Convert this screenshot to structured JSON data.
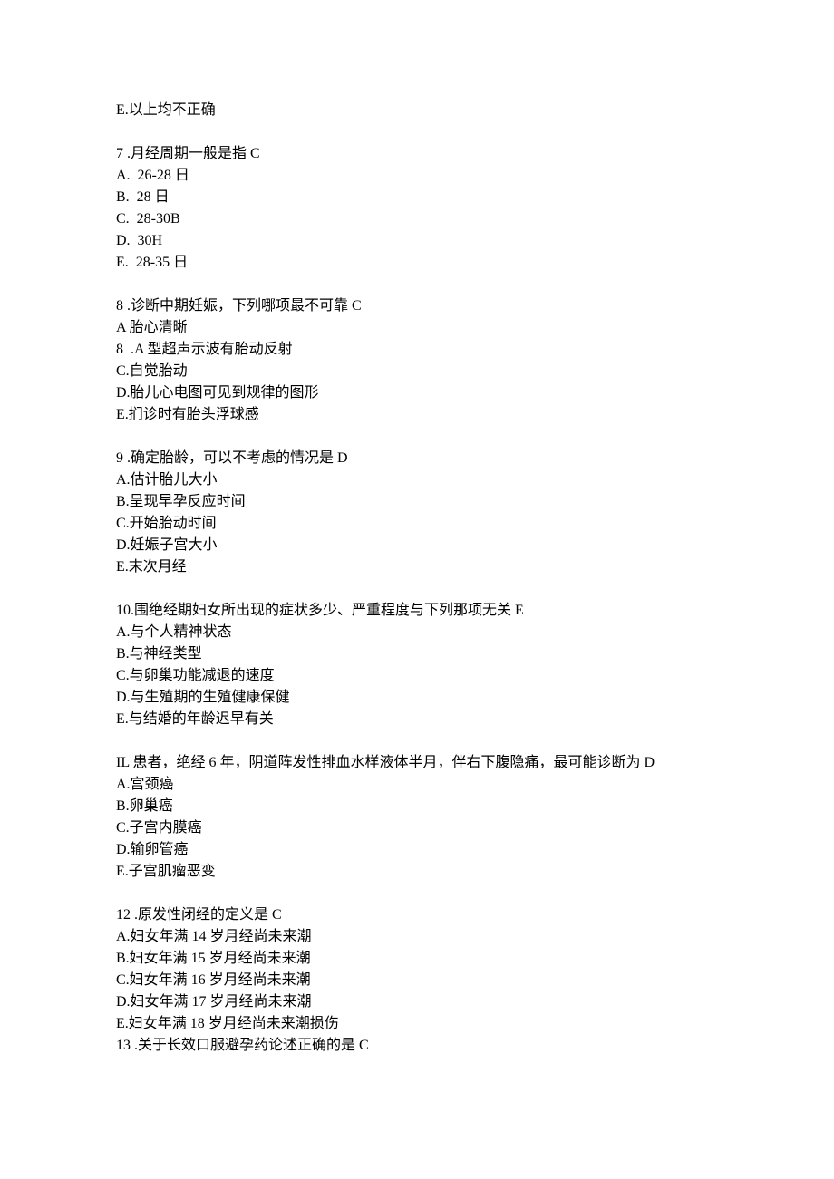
{
  "lines": [
    "E.以上均不正确",
    "",
    "7 .月经周期一般是指 C",
    "A.  26-28 日",
    "B.  28 日",
    "C.  28-30B",
    "D.  30H",
    "E.  28-35 日",
    "",
    "8 .诊断中期妊娠，下列哪项最不可靠 C",
    "A 胎心清晰",
    "8  .A 型超声示波有胎动反射",
    "C.自觉胎动",
    "D.胎儿心电图可见到规律的图形",
    "E.扪诊时有胎头浮球感",
    "",
    "9 .确定胎龄，可以不考虑的情况是 D",
    "A.估计胎儿大小",
    "B.呈现早孕反应时间",
    "C.开始胎动时间",
    "D.妊娠子宫大小",
    "E.末次月经",
    "",
    "10.围绝经期妇女所出现的症状多少、严重程度与下列那项无关 E",
    "A.与个人精神状态",
    "B.与神经类型",
    "C.与卵巢功能减退的速度",
    "D.与生殖期的生殖健康保健",
    "E.与结婚的年龄迟早有关",
    "",
    "IL 患者，绝经 6 年，阴道阵发性排血水样液体半月，伴右下腹隐痛，最可能诊断为 D",
    "A.宫颈癌",
    "B.卵巢癌",
    "C.子宫内膜癌",
    "D.输卵管癌",
    "E.子宫肌瘤恶变",
    "",
    "12 .原发性闭经的定义是 C",
    "A.妇女年满 14 岁月经尚未来潮",
    "B.妇女年满 15 岁月经尚未来潮",
    "C.妇女年满 16 岁月经尚未来潮",
    "D.妇女年满 17 岁月经尚未来潮",
    "E.妇女年满 18 岁月经尚未来潮损伤",
    "13 .关于长效口服避孕药论述正确的是 C"
  ]
}
